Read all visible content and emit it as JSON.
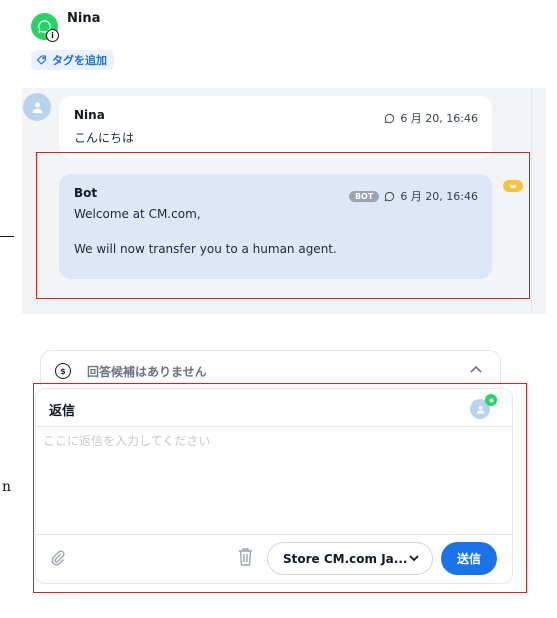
{
  "contact": {
    "name": "Nina",
    "tag_button": "タグを追加"
  },
  "messages": [
    {
      "author": "Nina",
      "timestamp": "6 月 20, 16:46",
      "lines": [
        "こんにちは"
      ],
      "channel_icon": "whatsapp-icon"
    },
    {
      "author": "Bot",
      "badge": "BOT",
      "timestamp": "6 月 20, 16:46",
      "lines": [
        "Welcome at CM.com,",
        "We will now transfer you to a human agent."
      ],
      "channel_icon": "whatsapp-icon"
    }
  ],
  "suggestions": {
    "text": "回答候補はありません"
  },
  "reply": {
    "title": "返信",
    "placeholder": "ここに返信を入力してください",
    "channel_select": "Store CM.com Ja...",
    "send_label": "送信"
  },
  "left_margin_glyph": "n",
  "colors": {
    "whatsapp_green": "#25d366",
    "accent_blue": "#1a73e8",
    "bot_bubble": "#dde7f8",
    "highlight_red": "#d32222"
  }
}
